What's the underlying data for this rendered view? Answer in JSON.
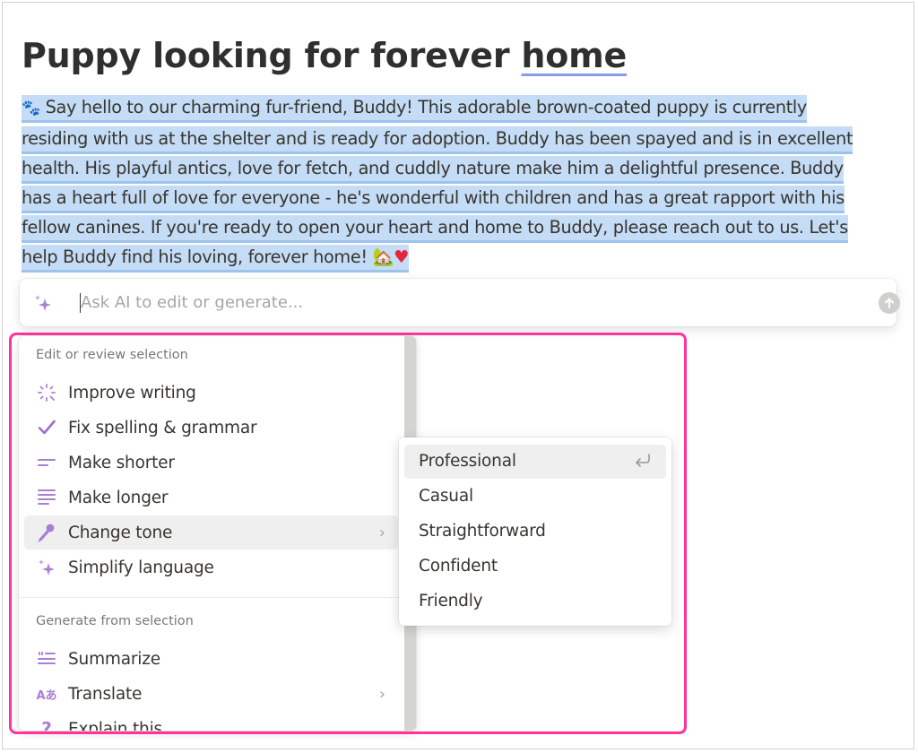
{
  "page": {
    "title_prefix": "Puppy looking for forever ",
    "title_underlined": "home",
    "body_lines": [
      "Say hello to our charming fur-friend, Buddy! This adorable brown-coated puppy is currently",
      "residing with us at the shelter and is ready for adoption. Buddy has been spayed and is in excellent",
      "health. His playful antics, love for fetch, and cuddly nature make him a delightful presence. Buddy",
      "has a heart full of love for everyone - he's wonderful with children and has a great rapport with his",
      "fellow canines. If you're ready to open your heart and home to Buddy, please reach out to us. Let's",
      "help Buddy find his loving, forever home!"
    ],
    "lead_emoji": "🐾",
    "trail_emoji_house": "🏡",
    "trail_emoji_heart": "♥"
  },
  "ai_bar": {
    "placeholder": "Ask AI to edit or generate...",
    "value": "",
    "icon": "sparkle-icon",
    "submit_icon": "arrow-up-icon"
  },
  "menu": {
    "sections": [
      {
        "label": "Edit or review selection",
        "items": [
          {
            "label": "Improve writing",
            "icon": "magic-wand-icon"
          },
          {
            "label": "Fix spelling & grammar",
            "icon": "checkmark-icon"
          },
          {
            "label": "Make shorter",
            "icon": "short-lines-icon"
          },
          {
            "label": "Make longer",
            "icon": "long-lines-icon"
          },
          {
            "label": "Change tone",
            "icon": "microphone-icon",
            "has_submenu": true,
            "active": true
          },
          {
            "label": "Simplify language",
            "icon": "sparkle-icon"
          }
        ]
      },
      {
        "label": "Generate from selection",
        "items": [
          {
            "label": "Summarize",
            "icon": "summarize-icon"
          },
          {
            "label": "Translate",
            "icon": "translate-icon",
            "icon_text": "Aあ",
            "has_submenu": true
          },
          {
            "label": "Explain this",
            "icon": "question-icon",
            "icon_text": "?"
          }
        ]
      }
    ]
  },
  "submenu": {
    "options": [
      {
        "label": "Professional",
        "active": true,
        "shortcut_icon": "enter-icon"
      },
      {
        "label": "Casual"
      },
      {
        "label": "Straightforward"
      },
      {
        "label": "Confident"
      },
      {
        "label": "Friendly"
      }
    ]
  },
  "colors": {
    "selection": "#c4dcf6",
    "accent_purple": "#9b6fc7",
    "highlight_pink": "#ff3399",
    "title_underline": "#8a9ee0"
  }
}
